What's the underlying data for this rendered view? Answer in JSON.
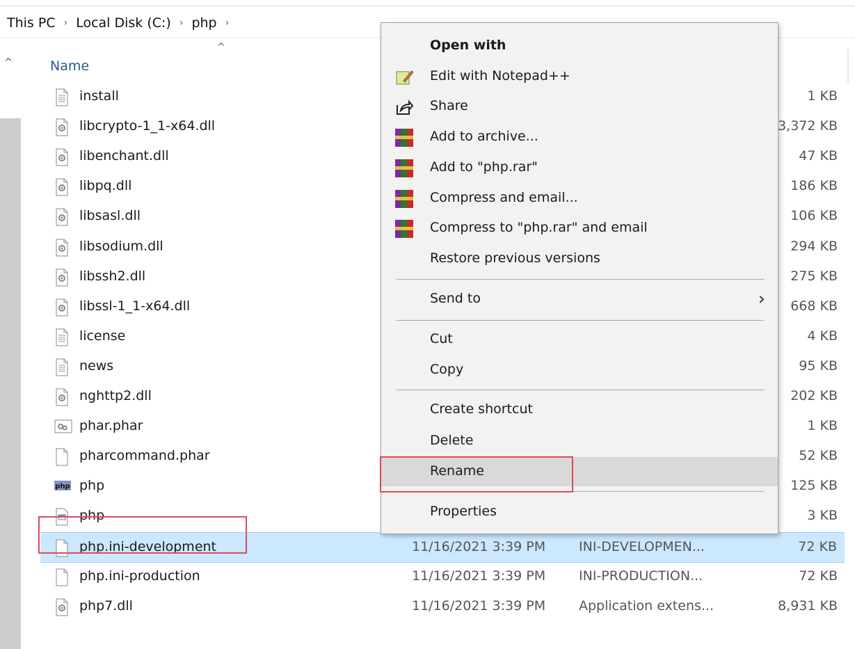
{
  "breadcrumb": {
    "items": [
      "This PC",
      "Local Disk (C:)",
      "php"
    ],
    "separator": "›"
  },
  "columns": {
    "name": "Name"
  },
  "files": [
    {
      "name": "install",
      "icon": "text-file-icon",
      "date": "",
      "type": "",
      "size": "1 KB"
    },
    {
      "name": "libcrypto-1_1-x64.dll",
      "icon": "dll-file-icon",
      "date": "",
      "type": "",
      "size": "3,372 KB"
    },
    {
      "name": "libenchant.dll",
      "icon": "dll-file-icon",
      "date": "",
      "type": "",
      "size": "47 KB"
    },
    {
      "name": "libpq.dll",
      "icon": "dll-file-icon",
      "date": "",
      "type": "",
      "size": "186 KB"
    },
    {
      "name": "libsasl.dll",
      "icon": "dll-file-icon",
      "date": "",
      "type": "",
      "size": "106 KB"
    },
    {
      "name": "libsodium.dll",
      "icon": "dll-file-icon",
      "date": "",
      "type": "",
      "size": "294 KB"
    },
    {
      "name": "libssh2.dll",
      "icon": "dll-file-icon",
      "date": "",
      "type": "",
      "size": "275 KB"
    },
    {
      "name": "libssl-1_1-x64.dll",
      "icon": "dll-file-icon",
      "date": "",
      "type": "",
      "size": "668 KB"
    },
    {
      "name": "license",
      "icon": "text-file-icon",
      "date": "",
      "type": "",
      "size": "4 KB"
    },
    {
      "name": "news",
      "icon": "text-file-icon",
      "date": "",
      "type": "",
      "size": "95 KB"
    },
    {
      "name": "nghttp2.dll",
      "icon": "dll-file-icon",
      "date": "",
      "type": "",
      "size": "202 KB"
    },
    {
      "name": "phar.phar",
      "icon": "phar-file-icon",
      "date": "",
      "type": "",
      "size": "1 KB"
    },
    {
      "name": "pharcommand.phar",
      "icon": "blank-file-icon",
      "date": "",
      "type": "",
      "size": "52 KB"
    },
    {
      "name": "php",
      "icon": "php-exe-icon",
      "date": "",
      "type": "",
      "size": "125 KB"
    },
    {
      "name": "php",
      "icon": "window-file-icon",
      "date": "",
      "type": "",
      "size": "3 KB"
    },
    {
      "name": "php.ini-development",
      "icon": "blank-file-icon",
      "date": "11/16/2021 3:39 PM",
      "type": "INI-DEVELOPMEN...",
      "size": "72 KB",
      "selected": true
    },
    {
      "name": "php.ini-production",
      "icon": "blank-file-icon",
      "date": "11/16/2021 3:39 PM",
      "type": "INI-PRODUCTION...",
      "size": "72 KB"
    },
    {
      "name": "php7.dll",
      "icon": "dll-file-icon",
      "date": "11/16/2021 3:39 PM",
      "type": "Application extens...",
      "size": "8,931 KB"
    }
  ],
  "context_menu": {
    "items": [
      {
        "label": "Open with",
        "icon": "",
        "bold": true
      },
      {
        "label": "Edit with Notepad++",
        "icon": "notepad-plus-plus-icon"
      },
      {
        "label": "Share",
        "icon": "share-icon"
      },
      {
        "label": "Add to archive...",
        "icon": "winrar-icon"
      },
      {
        "label": "Add to \"php.rar\"",
        "icon": "winrar-icon"
      },
      {
        "label": "Compress and email...",
        "icon": "winrar-icon"
      },
      {
        "label": "Compress to \"php.rar\" and email",
        "icon": "winrar-icon"
      },
      {
        "label": "Restore previous versions",
        "icon": ""
      },
      {
        "label": "Send to",
        "icon": "",
        "submenu": true
      },
      {
        "label": "Cut",
        "icon": ""
      },
      {
        "label": "Copy",
        "icon": ""
      },
      {
        "label": "Create shortcut",
        "icon": ""
      },
      {
        "label": "Delete",
        "icon": ""
      },
      {
        "label": "Rename",
        "icon": "",
        "highlighted": true
      },
      {
        "label": "Properties",
        "icon": ""
      }
    ]
  },
  "colors": {
    "selection": "#cce8ff",
    "highlight_box": "#e0485a",
    "menu_bg": "#f2f2f2"
  }
}
